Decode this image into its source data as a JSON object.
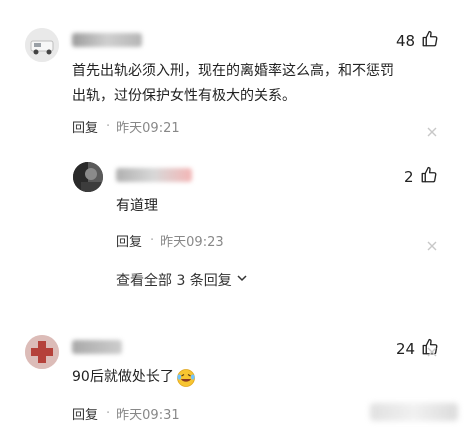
{
  "comments": [
    {
      "likes": "48",
      "text_line1": "首先出轨必须入刑，现在的离婚率这么高，和不惩罚",
      "text_line2": "出轨，过份保护女性有极大的关系。",
      "reply_label": "回复",
      "separator": "·",
      "time": "昨天09:21"
    },
    {
      "likes": "2",
      "text": "有道理",
      "reply_label": "回复",
      "separator": "·",
      "time": "昨天09:23",
      "more_replies": "查看全部 3 条回复"
    },
    {
      "likes": "24",
      "text": "90后就做处长了",
      "reply_label": "回复",
      "separator": "·",
      "time": "昨天09:31"
    }
  ],
  "icons": {
    "like": "thumbs-up-icon",
    "close": "close-icon",
    "chevron": "chevron-down-icon",
    "emoji": "laughing-crying-emoji-icon"
  },
  "colors": {
    "text": "#222222",
    "meta": "#888888",
    "close": "#c8c8c8"
  }
}
